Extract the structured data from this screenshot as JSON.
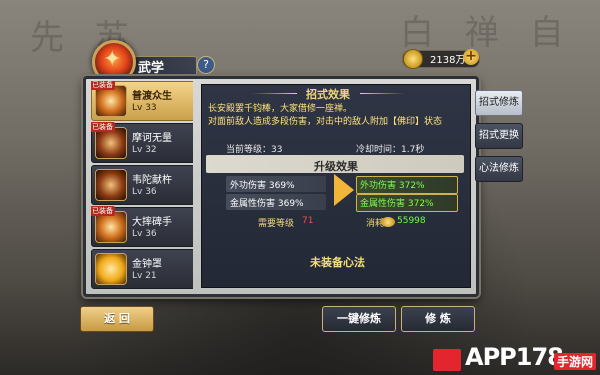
{
  "header": {
    "title": "武学",
    "help_glyph": "?",
    "currency": "2138万",
    "plus_glyph": "+"
  },
  "skills": [
    {
      "name": "普渡众生",
      "level": "Lv 33",
      "selected": true,
      "equipped": true
    },
    {
      "name": "摩诃无量",
      "level": "Lv 32",
      "selected": false,
      "equipped": true
    },
    {
      "name": "韦陀献杵",
      "level": "Lv 36",
      "selected": false,
      "equipped": false
    },
    {
      "name": "大摔碑手",
      "level": "Lv 36",
      "selected": false,
      "equipped": true
    },
    {
      "name": "金钟罩",
      "level": "Lv 21",
      "selected": false,
      "equipped": false
    }
  ],
  "equipped_badge": "已装备",
  "detail": {
    "effect_header": "招式效果",
    "desc_line1": "长安殿罢千钧棒，大家借修一座禅。",
    "desc_line2": "对面前敌人造成多段伤害，对击中的敌人附加【佛印】状态",
    "current_level_label": "当前等级：33",
    "cooldown_label": "冷却时间：1.7秒",
    "upgrade_header": "升级效果",
    "phys_before": "外功伤害 369%",
    "metal_before": "金属性伤害 369%",
    "phys_after": "外功伤害 372%",
    "metal_after": "金属性伤害 372%",
    "req_level_label": "需要等级",
    "req_level_value": "71",
    "cost_label": "消耗:",
    "cost_value": "55998",
    "empty_text": "未装备心法"
  },
  "tabs": [
    "招式修炼",
    "招式更换",
    "心法修炼"
  ],
  "buttons": {
    "back": "返 回",
    "onekey": "一键修炼",
    "cultivate": "修 炼"
  },
  "watermark": {
    "main": "APP178",
    "sub": "手游网"
  },
  "background_chars": [
    "先",
    "苏",
    "白",
    "禅",
    "自"
  ]
}
